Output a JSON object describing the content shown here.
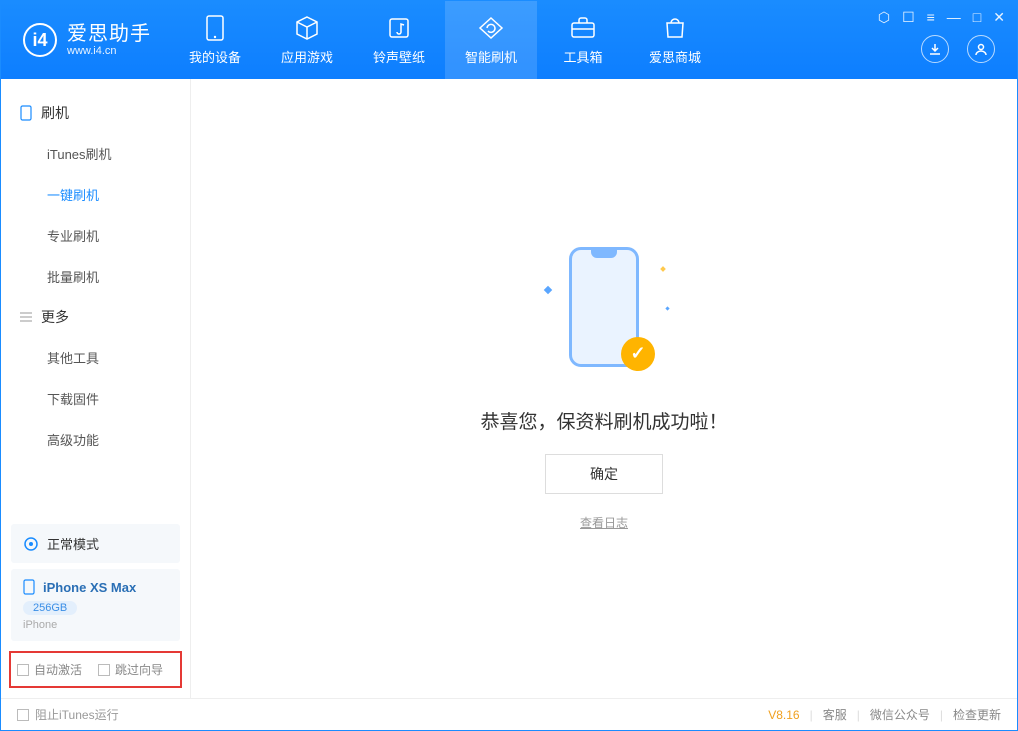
{
  "app": {
    "name_cn": "爱思助手",
    "name_en": "www.i4.cn"
  },
  "nav": [
    {
      "label": "我的设备",
      "icon": "device-icon"
    },
    {
      "label": "应用游戏",
      "icon": "cube-icon"
    },
    {
      "label": "铃声壁纸",
      "icon": "music-icon"
    },
    {
      "label": "智能刷机",
      "icon": "refresh-icon",
      "active": true
    },
    {
      "label": "工具箱",
      "icon": "toolbox-icon"
    },
    {
      "label": "爱思商城",
      "icon": "bag-icon"
    }
  ],
  "sidebar": {
    "group1_title": "刷机",
    "group1_items": [
      "iTunes刷机",
      "一键刷机",
      "专业刷机",
      "批量刷机"
    ],
    "group1_active_index": 1,
    "group2_title": "更多",
    "group2_items": [
      "其他工具",
      "下载固件",
      "高级功能"
    ]
  },
  "device_mode": {
    "label": "正常模式"
  },
  "device_info": {
    "name": "iPhone XS Max",
    "storage": "256GB",
    "type": "iPhone"
  },
  "checkboxes": {
    "auto_activate": "自动激活",
    "skip_guide": "跳过向导"
  },
  "main": {
    "success_text": "恭喜您，保资料刷机成功啦！",
    "ok_button": "确定",
    "log_link": "查看日志"
  },
  "footer": {
    "block_itunes": "阻止iTunes运行",
    "version": "V8.16",
    "links": [
      "客服",
      "微信公众号",
      "检查更新"
    ]
  }
}
